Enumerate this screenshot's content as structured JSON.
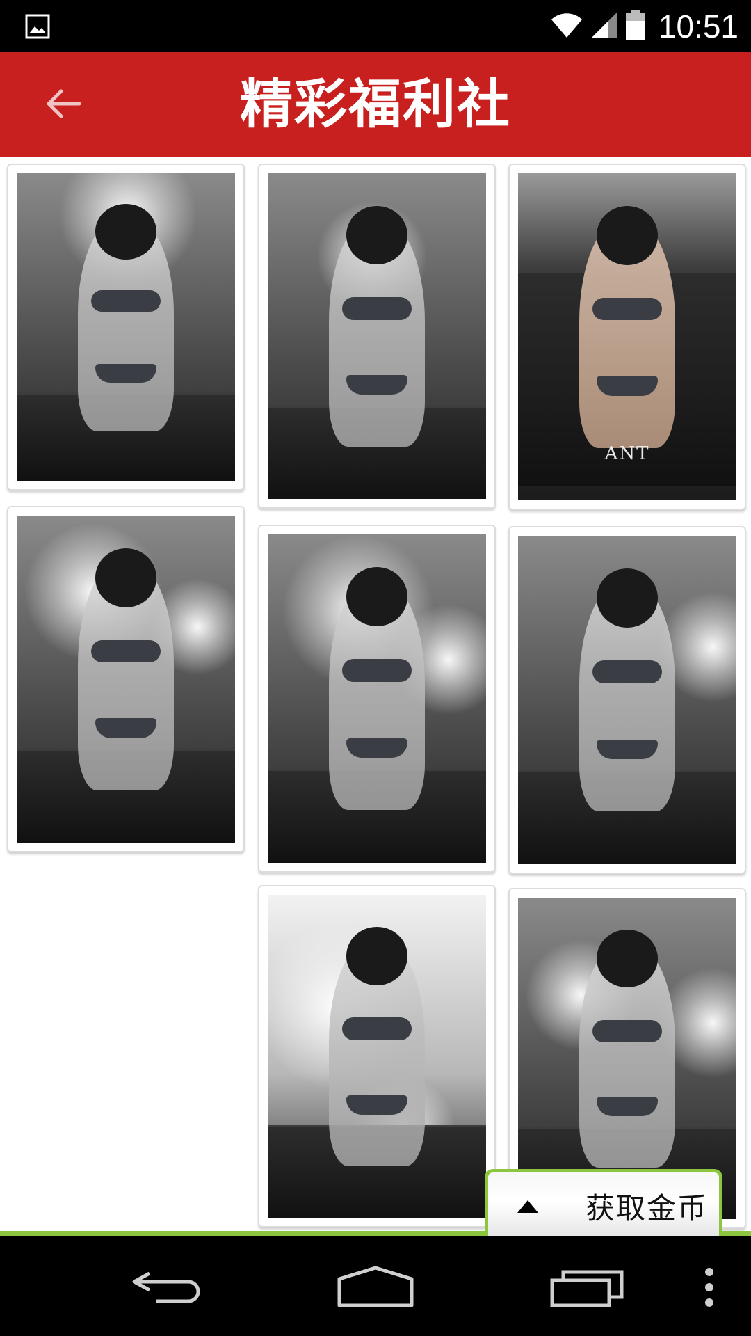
{
  "status_bar": {
    "time": "10:51",
    "icons": [
      "gallery-notification-icon",
      "wifi-icon",
      "signal-icon",
      "battery-icon"
    ]
  },
  "header": {
    "title": "精彩福利社",
    "back_icon": "back-arrow-icon",
    "background_color": "#c8201f"
  },
  "gallery": {
    "photos": [
      {
        "name": "photo-1",
        "watermark": ""
      },
      {
        "name": "photo-2",
        "watermark": ""
      },
      {
        "name": "photo-3",
        "watermark": "ANT"
      },
      {
        "name": "photo-4",
        "watermark": ""
      },
      {
        "name": "photo-5",
        "watermark": ""
      },
      {
        "name": "photo-6",
        "watermark": ""
      },
      {
        "name": "photo-7",
        "watermark": ""
      },
      {
        "name": "photo-8",
        "watermark": ""
      }
    ]
  },
  "get_coins": {
    "label": "获取金币",
    "icon": "expand-up-icon",
    "border_color": "#8cc63f"
  },
  "nav_bar": {
    "icons": [
      "nav-back-icon",
      "nav-home-icon",
      "nav-recents-icon",
      "nav-menu-icon"
    ]
  }
}
